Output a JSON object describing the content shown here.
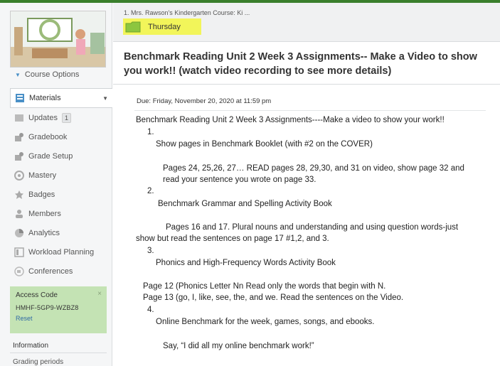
{
  "sidebar": {
    "course_options": "Course Options",
    "items": [
      {
        "label": "Materials",
        "icon": "materials-icon"
      },
      {
        "label": "Updates",
        "icon": "updates-icon",
        "count": "1"
      },
      {
        "label": "Gradebook",
        "icon": "gradebook-icon"
      },
      {
        "label": "Grade Setup",
        "icon": "grade-setup-icon"
      },
      {
        "label": "Mastery",
        "icon": "mastery-icon"
      },
      {
        "label": "Badges",
        "icon": "badge-icon"
      },
      {
        "label": "Members",
        "icon": "members-icon"
      },
      {
        "label": "Analytics",
        "icon": "analytics-icon"
      },
      {
        "label": "Workload Planning",
        "icon": "workload-icon"
      },
      {
        "label": "Conferences",
        "icon": "conferences-icon"
      }
    ],
    "access_code": {
      "title": "Access Code",
      "code": "HMHF-5GP9-WZBZ8",
      "reset": "Reset",
      "close": "×"
    },
    "information": "Information",
    "grading_periods": "Grading periods"
  },
  "breadcrumb": {
    "course": "1. Mrs. Rawson's Kindergarten Course: Ki ...",
    "folder": "Thursday"
  },
  "assignment": {
    "title": "Benchmark Reading Unit 2 Week 3 Assignments-- Make a Video to show you work!! (watch video recording to see more details)",
    "due": "Due: Friday, November 20, 2020 at 11:59 pm",
    "lines": [
      "Benchmark Reading Unit 2 Week 3 Assignments----Make a video to show your work!!",
      "1.",
      "Show pages in Benchmark Booklet (with #2 on the COVER)",
      "Pages 24, 25,26, 27… READ pages 28, 29,30,  and 31 on video, show page 32 and",
      "read your sentence you wrote on page 33.",
      "2.",
      "Benchmark Grammar and Spelling Activity Book",
      "Pages 16 and 17. Plural nouns and understanding and using question words-just",
      "show but read the sentences on page 17 #1,2, and 3.",
      "3.",
      "Phonics and High-Frequency Words Activity Book",
      "Page 12 (Phonics Letter Nn Read only the words that begin with N.",
      "Page 13 (go, I, like, see, the, and we.   Read the sentences on the Video.",
      "4.",
      "Online Benchmark for the week, games, songs, and ebooks.",
      "Say, “I did all my online benchmark work!”"
    ]
  },
  "colors": {
    "accent_green": "#3a7f2c",
    "highlight_yellow": "#f2f55a",
    "folder_green": "#8cc63f",
    "access_bg": "#c4e3b4"
  }
}
